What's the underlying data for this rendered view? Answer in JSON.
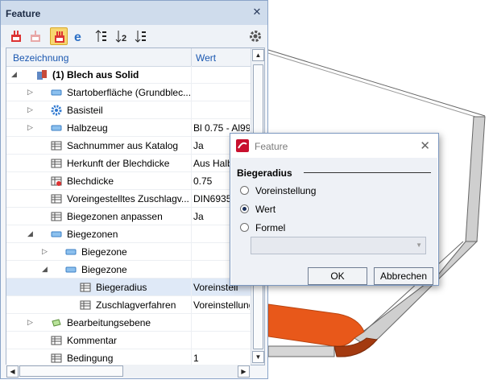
{
  "panel": {
    "title": "Feature",
    "close_glyph": "✕",
    "toolbar": [
      {
        "icon": "feature-red-icon"
      },
      {
        "icon": "feature-gray-icon"
      },
      {
        "icon": "feature-active-icon"
      },
      {
        "icon": "e-icon"
      },
      {
        "icon": "sort-1-icon"
      },
      {
        "icon": "sort-2-icon"
      },
      {
        "icon": "sort-3-icon"
      },
      {
        "icon": "gear-icon"
      }
    ],
    "columns": {
      "name": "Bezeichnung",
      "value": "Wert"
    },
    "rows": [
      {
        "label": "(1) Blech aus Solid",
        "value": "",
        "bold": true,
        "expander": "◢",
        "icon": "solid-icon"
      },
      {
        "label": "Startoberfläche (Grundblec...",
        "value": "",
        "expander": "▷",
        "icon": "surface-icon"
      },
      {
        "label": "Basisteil",
        "value": "",
        "expander": "▷",
        "icon": "cog-blue-icon"
      },
      {
        "label": "Halbzeug",
        "value": "Bl 0.75 - Al99",
        "expander": "▷",
        "icon": "surface-icon"
      },
      {
        "label": "Sachnummer aus Katalog",
        "value": "Ja",
        "expander": "",
        "icon": "table-icon"
      },
      {
        "label": "Herkunft der Blechdicke",
        "value": "Aus Halbz",
        "expander": "",
        "icon": "table-icon"
      },
      {
        "label": "Blechdicke",
        "value": "0.75",
        "expander": "",
        "icon": "table-red-icon"
      },
      {
        "label": "Voreingestelltes Zuschlagv...",
        "value": "DIN6935",
        "expander": "",
        "icon": "table-icon"
      },
      {
        "label": "Biegezonen anpassen",
        "value": "Ja",
        "expander": "",
        "icon": "table-icon"
      },
      {
        "label": "Biegezonen",
        "value": "",
        "expander": "◢",
        "icon": "surface-icon"
      },
      {
        "label": "Biegezone",
        "value": "",
        "expander": "▷",
        "icon": "surface-icon"
      },
      {
        "label": "Biegezone",
        "value": "",
        "expander": "◢",
        "icon": "surface-icon"
      },
      {
        "label": "Biegeradius",
        "value": "Voreinstell",
        "expander": "",
        "icon": "table-icon",
        "selected": true
      },
      {
        "label": "Zuschlagverfahren",
        "value": "Voreinstellung",
        "expander": "",
        "icon": "table-icon"
      },
      {
        "label": "Bearbeitungsebene",
        "value": "",
        "expander": "▷",
        "icon": "plane-icon"
      },
      {
        "label": "Kommentar",
        "value": "",
        "expander": "",
        "icon": "table-icon"
      },
      {
        "label": "Bedingung",
        "value": "1",
        "expander": "",
        "icon": "table-icon"
      }
    ]
  },
  "dialog": {
    "title": "Feature",
    "close_glyph": "✕",
    "group_title": "Biegeradius",
    "options": [
      {
        "label": "Voreinstellung",
        "checked": false
      },
      {
        "label": "Wert",
        "checked": true
      },
      {
        "label": "Formel",
        "checked": false
      }
    ],
    "formula_value": "",
    "ok_label": "OK",
    "cancel_label": "Abbrechen"
  },
  "colors": {
    "accent_orange": "#e8581a",
    "accent_dark_red": "#a33a10",
    "selection": "#dfe9f7",
    "header_text": "#1a57b0"
  }
}
